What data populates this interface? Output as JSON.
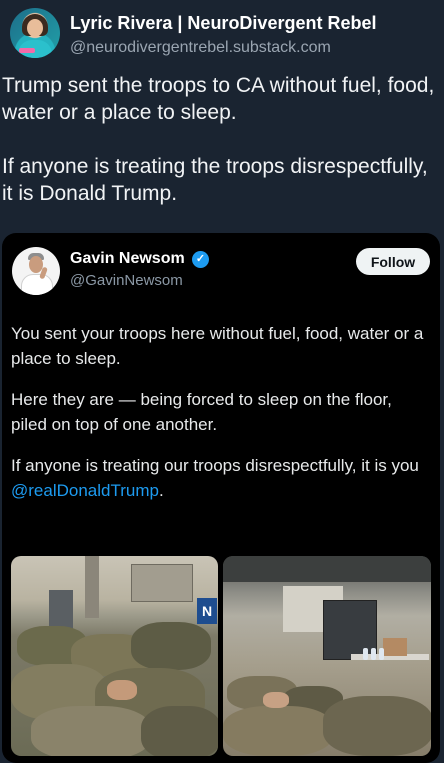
{
  "post": {
    "author_name": "Lyric Rivera | NeuroDivergent Rebel",
    "author_handle": "@neurodivergentrebel.substack.com",
    "text": "Trump sent the troops to CA without fuel, food, water or a place to sleep.\n\nIf anyone is treating the troops disrespectfully, it is Donald Trump."
  },
  "quoted": {
    "author_name": "Gavin Newsom",
    "author_handle": "@GavinNewsom",
    "follow_label": "Follow",
    "paragraph1": "You sent your troops here without fuel, food, water or a place to sleep.",
    "paragraph2": "Here they are — being forced to sleep on the floor, piled on top of one another.",
    "paragraph3_prefix": "If anyone is treating our troops disrespectfully, it is you ",
    "mention": "@realDonaldTrump",
    "paragraph3_suffix": ".",
    "sign_letter": "N"
  },
  "colors": {
    "background": "#1a2431",
    "quote_card": "#000000",
    "accent_link": "#1d9bf0",
    "verified": "#1d9bf0"
  },
  "icons": {
    "verified": "verified-badge-icon"
  }
}
